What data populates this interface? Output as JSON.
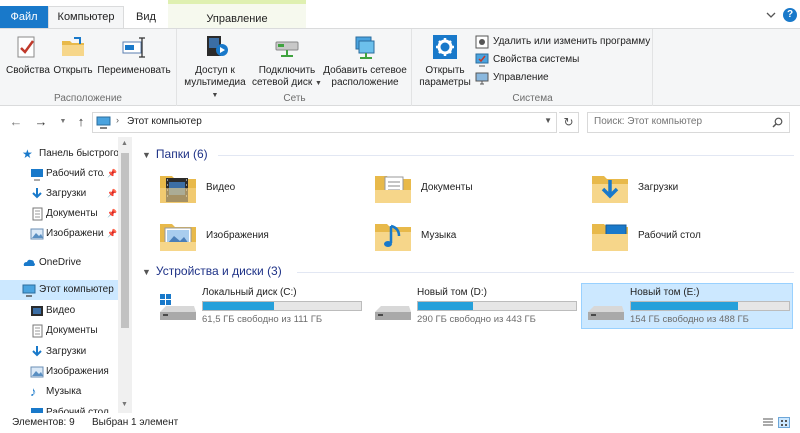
{
  "ribbon": {
    "tabs": {
      "file": "Файл",
      "computer": "Компьютер",
      "view": "Вид",
      "manage": "Управление"
    },
    "help": "?",
    "groups": {
      "location": {
        "label": "Расположение",
        "properties": "Свойства",
        "open": "Открыть",
        "rename": "Переименовать"
      },
      "network": {
        "label": "Сеть",
        "media_access_line1": "Доступ к",
        "media_access_line2": "мультимедиа",
        "map_drive_line1": "Подключить",
        "map_drive_line2": "сетевой диск",
        "add_location_line1": "Добавить сетевое",
        "add_location_line2": "расположение"
      },
      "system": {
        "label": "Система",
        "open_settings_line1": "Открыть",
        "open_settings_line2": "параметры",
        "uninstall": "Удалить или изменить программу",
        "system_properties": "Свойства системы",
        "manage": "Управление"
      }
    }
  },
  "address": {
    "path": "Этот компьютер",
    "search_placeholder": "Поиск: Этот компьютер"
  },
  "nav": {
    "items": [
      {
        "label": "Панель быстрого доступа"
      },
      {
        "label": "Рабочий стол"
      },
      {
        "label": "Загрузки"
      },
      {
        "label": "Документы"
      },
      {
        "label": "Изображения"
      },
      {
        "label": "OneDrive"
      },
      {
        "label": "Этот компьютер"
      },
      {
        "label": "Видео"
      },
      {
        "label": "Документы"
      },
      {
        "label": "Загрузки"
      },
      {
        "label": "Изображения"
      },
      {
        "label": "Музыка"
      },
      {
        "label": "Рабочий стол"
      }
    ]
  },
  "folders": {
    "header": "Папки (6)",
    "items": [
      {
        "name": "Видео"
      },
      {
        "name": "Документы"
      },
      {
        "name": "Загрузки"
      },
      {
        "name": "Изображения"
      },
      {
        "name": "Музыка"
      },
      {
        "name": "Рабочий стол"
      }
    ]
  },
  "drives": {
    "header": "Устройства и диски (3)",
    "items": [
      {
        "name": "Локальный диск (C:)",
        "free": "61,5 ГБ свободно из 111 ГБ",
        "used_fraction": 0.45
      },
      {
        "name": "Новый том (D:)",
        "free": "290 ГБ свободно из 443 ГБ",
        "used_fraction": 0.35
      },
      {
        "name": "Новый том (E:)",
        "free": "154 ГБ свободно из 488 ГБ",
        "used_fraction": 0.68
      }
    ]
  },
  "status": {
    "items": "Элементов: 9",
    "selected": "Выбран 1 элемент"
  },
  "colors": {
    "accent": "#1979ca",
    "selection": "#cce8ff",
    "drive_bar": "#26a0da",
    "section_header": "#1e3287"
  }
}
